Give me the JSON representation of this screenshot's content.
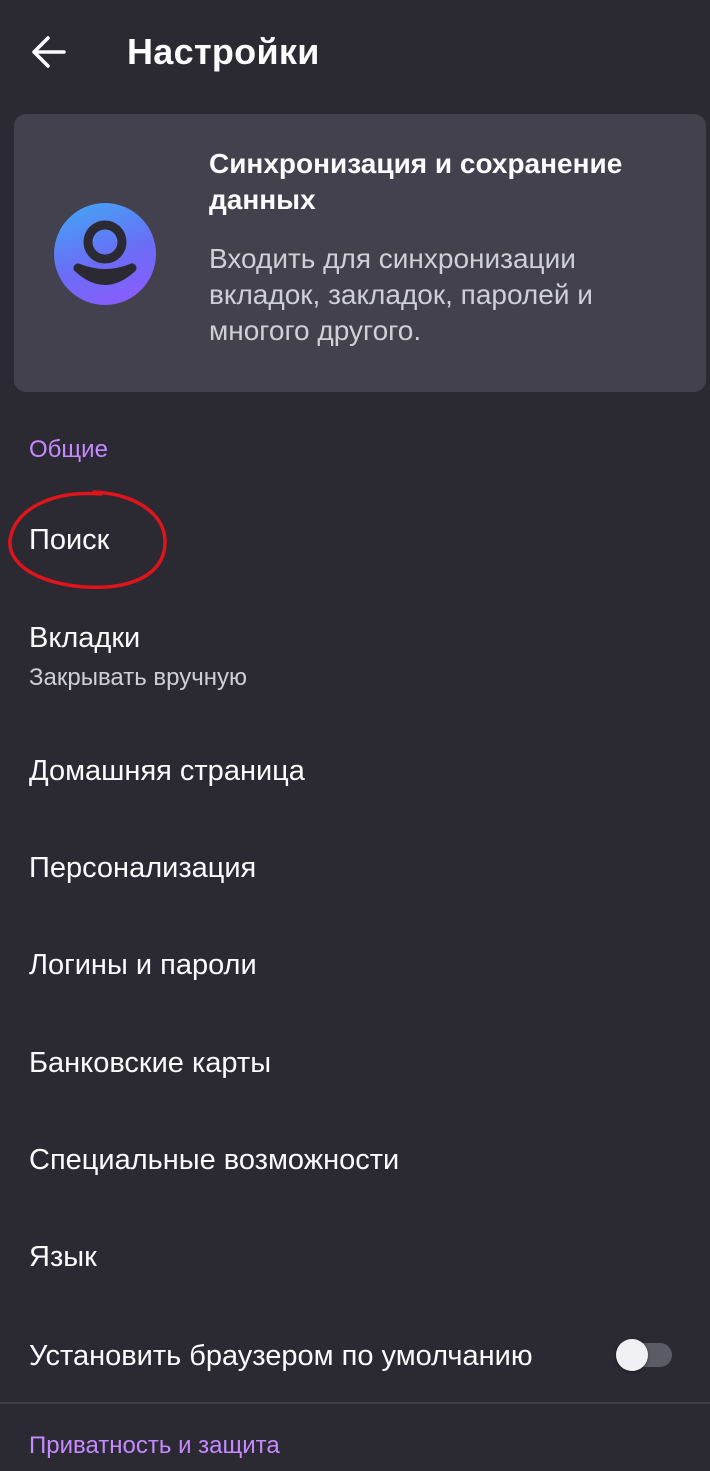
{
  "header": {
    "title": "Настройки",
    "back_icon": "arrow-left-icon"
  },
  "sync_card": {
    "title": "Синхронизация и сохранение данных",
    "description": "Входить для синхронизации вкладок, закладок, паролей и многого другого.",
    "avatar_icon": "account-avatar-icon",
    "avatar_gradient": [
      "#3fa9f5",
      "#6b6cf6",
      "#9059ff"
    ]
  },
  "sections": {
    "general": {
      "title": "Общие",
      "items": [
        {
          "label": "Поиск"
        },
        {
          "label": "Вкладки",
          "sublabel": "Закрывать вручную"
        },
        {
          "label": "Домашняя страница"
        },
        {
          "label": "Персонализация"
        },
        {
          "label": "Логины и пароли"
        },
        {
          "label": "Банковские карты"
        },
        {
          "label": "Специальные возможности"
        },
        {
          "label": "Язык"
        },
        {
          "label": "Установить браузером по умолчанию",
          "toggle": false
        }
      ]
    },
    "privacy": {
      "title": "Приватность и защита"
    }
  },
  "annotation": {
    "shape": "ellipse",
    "color": "#e0141b",
    "target": "Поиск"
  },
  "colors": {
    "background": "#2b2a33",
    "card": "#42414d",
    "accent": "#c689ff",
    "text": "#fbfbfe",
    "secondary_text": "#cfcfd8"
  }
}
